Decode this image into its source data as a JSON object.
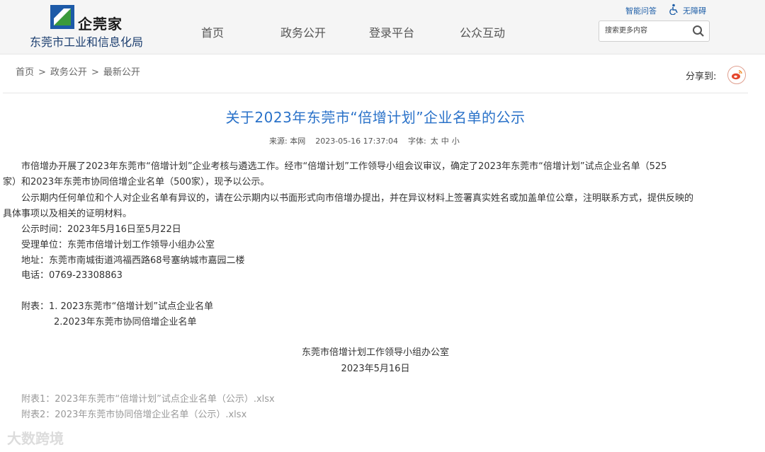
{
  "header": {
    "logo_text": "企莞家",
    "org_name": "东莞市工业和信息化局",
    "nav": [
      "首页",
      "政务公开",
      "登录平台",
      "公众互动"
    ],
    "top_links": {
      "smart_qa": "智能问答",
      "accessibility": "无障碍"
    },
    "search": {
      "placeholder": "搜索更多内容",
      "value": ""
    }
  },
  "breadcrumb": [
    "首页",
    "政务公开",
    "最新公开"
  ],
  "breadcrumb_sep": ">",
  "share": {
    "label": "分享到:"
  },
  "article": {
    "title": "关于2023年东莞市“倍增计划”企业名单的公示",
    "meta": {
      "source": "来源: 本网",
      "datetime": "2023-05-16 17:37:04",
      "font_label": "字体:",
      "font_sizes": [
        "太",
        "中",
        "小"
      ]
    },
    "lines": [
      "市倍增办开展了2023年东莞市“倍增计划”企业考核与遴选工作。经市“倍增计划”工作领导小组会议审议，确定了2023年东莞市“倍增计划”试点企业名单（525",
      "家）和2023年东莞市协同倍增企业名单（500家），现予以公示。",
      "公示期内任何单位和个人对企业名单有异议的，请在公示期内以书面形式向市倍增办提出，并在异议材料上签署真实姓名或加盖单位公章，注明联系方式，提供反映的",
      "具体事项以及相关的证明材料。",
      "公示时间：2023年5月16日至5月22日",
      "受理单位：东莞市倍增计划工作领导小组办公室",
      "地址：东莞市南城街道鸿福西路68号塞纳城市嘉园二楼",
      "电话：0769-23308863",
      "附表：1. 2023东莞市“倍增计划”试点企业名单",
      "2.2023年东莞市协同倍增企业名单"
    ],
    "signature": [
      "东莞市倍增计划工作领导小组办公室",
      "2023年5月16日"
    ],
    "attachments": [
      "附表1：2023年东莞市“倍增计划”试点企业名单（公示）.xlsx",
      "附表2：2023年东莞市协同倍增企业名单（公示）.xlsx"
    ]
  },
  "watermark": "大数跨境",
  "colors": {
    "title": "#2a72c9",
    "org_name": "#1d3f70",
    "link": "#1f5fa8",
    "attachment": "#999999"
  }
}
